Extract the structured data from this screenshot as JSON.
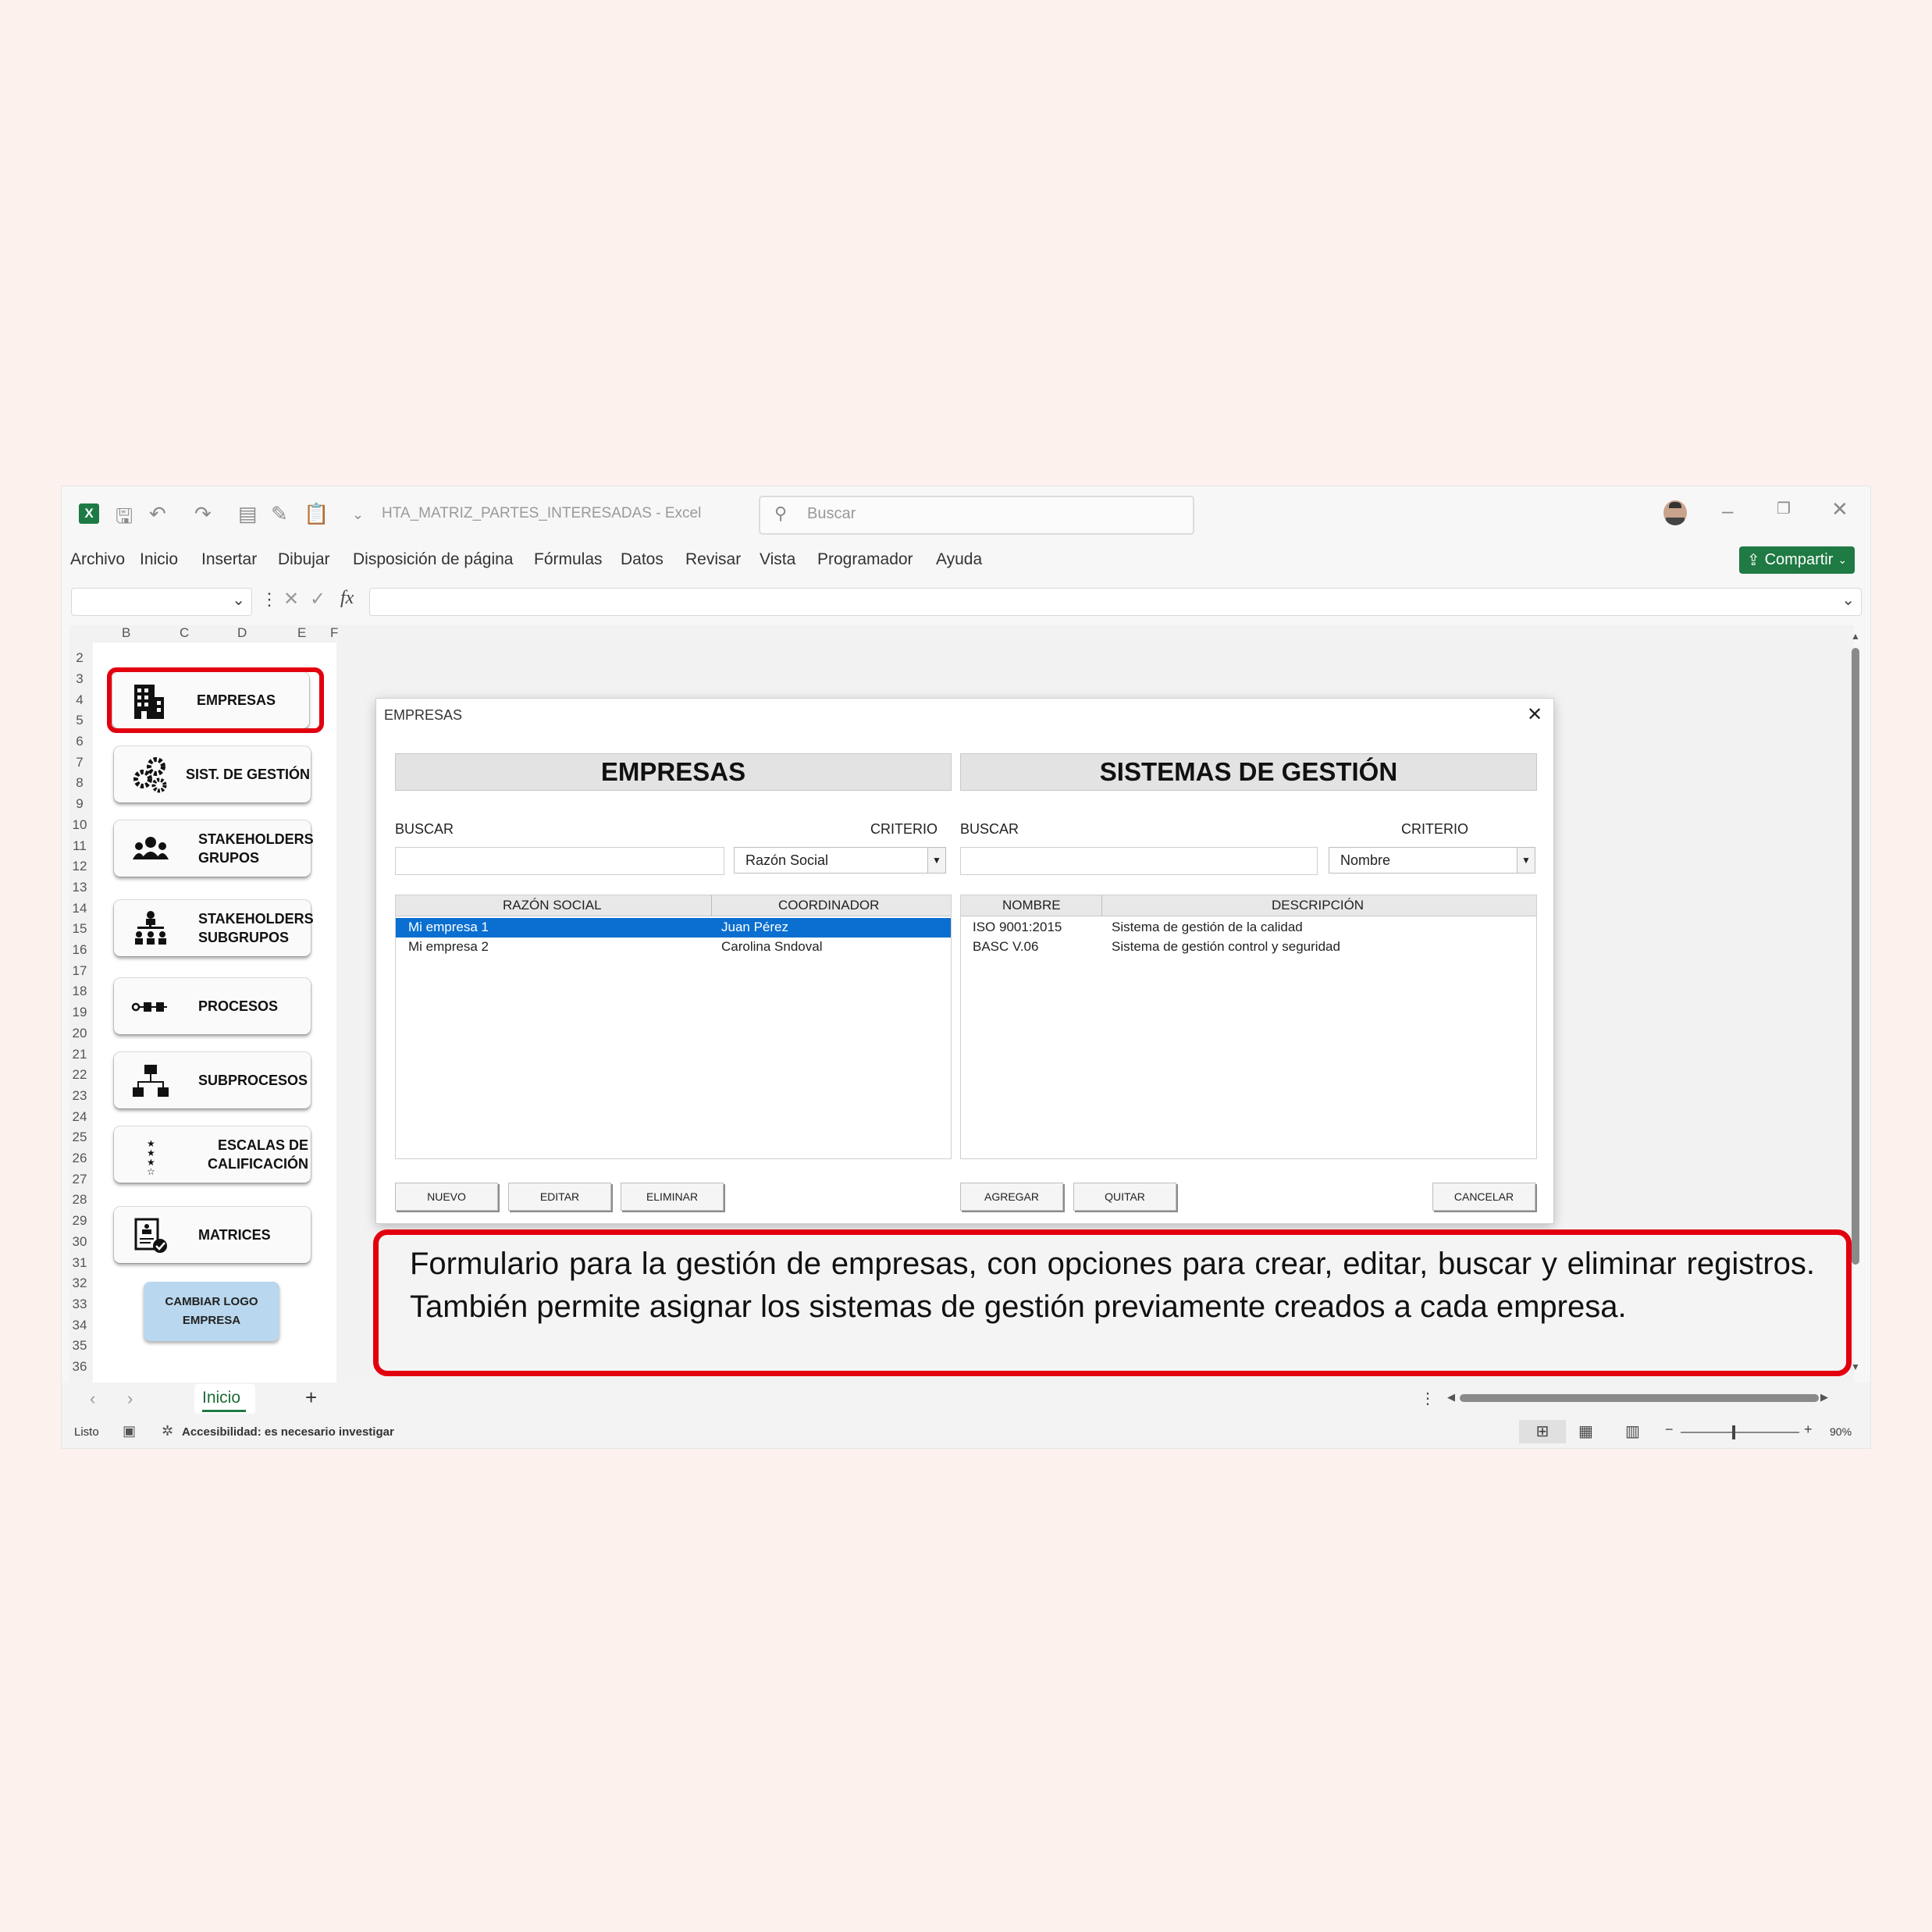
{
  "window": {
    "doc_title": "HTA_MATRIZ_PARTES_INTERESADAS",
    "app_name": "Excel",
    "search_placeholder": "Buscar"
  },
  "menu": [
    "Archivo",
    "Inicio",
    "Insertar",
    "Dibujar",
    "Disposición de página",
    "Fórmulas",
    "Datos",
    "Revisar",
    "Vista",
    "Programador",
    "Ayuda"
  ],
  "share_label": "Compartir",
  "formula": {
    "fx": "fx"
  },
  "columns": [
    "B",
    "C",
    "D",
    "E",
    "F"
  ],
  "rows": [
    "2",
    "3",
    "4",
    "5",
    "6",
    "7",
    "8",
    "9",
    "10",
    "11",
    "12",
    "13",
    "14",
    "15",
    "16",
    "17",
    "18",
    "19",
    "20",
    "21",
    "22",
    "23",
    "24",
    "25",
    "26",
    "27",
    "28",
    "29",
    "30",
    "31",
    "32",
    "33",
    "34",
    "35",
    "36"
  ],
  "nav": {
    "empresas": "EMPRESAS",
    "sist": "SIST. DE GESTIÓN",
    "stk_grupos_1": "STAKEHOLDERS",
    "stk_grupos_2": "GRUPOS",
    "stk_sub_1": "STAKEHOLDERS",
    "stk_sub_2": "SUBGRUPOS",
    "procesos": "PROCESOS",
    "subprocesos": "SUBPROCESOS",
    "escalas_1": "ESCALAS DE",
    "escalas_2": "CALIFICACIÓN",
    "matrices": "MATRICES",
    "logo_1": "CAMBIAR LOGO",
    "logo_2": "EMPRESA"
  },
  "dialog": {
    "title": "EMPRESAS",
    "left": {
      "header": "EMPRESAS",
      "buscar": "BUSCAR",
      "criterio": "CRITERIO",
      "criterio_value": "Razón Social",
      "col1": "RAZÓN SOCIAL",
      "col2": "COORDINADOR",
      "rows": [
        {
          "a": "Mi empresa 1",
          "b": "Juan Pérez"
        },
        {
          "a": "Mi empresa 2",
          "b": "Carolina Sndoval"
        }
      ],
      "btn_nuevo": "NUEVO",
      "btn_editar": "EDITAR",
      "btn_eliminar": "ELIMINAR"
    },
    "right": {
      "header": "SISTEMAS DE GESTIÓN",
      "buscar": "BUSCAR",
      "criterio": "CRITERIO",
      "criterio_value": "Nombre",
      "col1": "NOMBRE",
      "col2": "DESCRIPCIÓN",
      "rows": [
        {
          "a": "ISO 9001:2015",
          "b": "Sistema de gestión de la calidad"
        },
        {
          "a": "BASC V.06",
          "b": "Sistema de gestión control y seguridad"
        }
      ],
      "btn_agregar": "AGREGAR",
      "btn_quitar": "QUITAR",
      "btn_cancelar": "CANCELAR"
    }
  },
  "annotation": "Formulario para la gestión de empresas, con opciones para crear, editar, buscar y eliminar registros. También permite asignar los sistemas de gestión previamente creados a cada empresa.",
  "sheet_tab": "Inicio",
  "status": {
    "ready": "Listo",
    "accessibility": "Accesibilidad: es necesario investigar",
    "zoom": "90%"
  },
  "colors": {
    "accent_red": "#e2000f",
    "excel_green": "#1f7a43",
    "selection_blue": "#0a6fd0"
  }
}
